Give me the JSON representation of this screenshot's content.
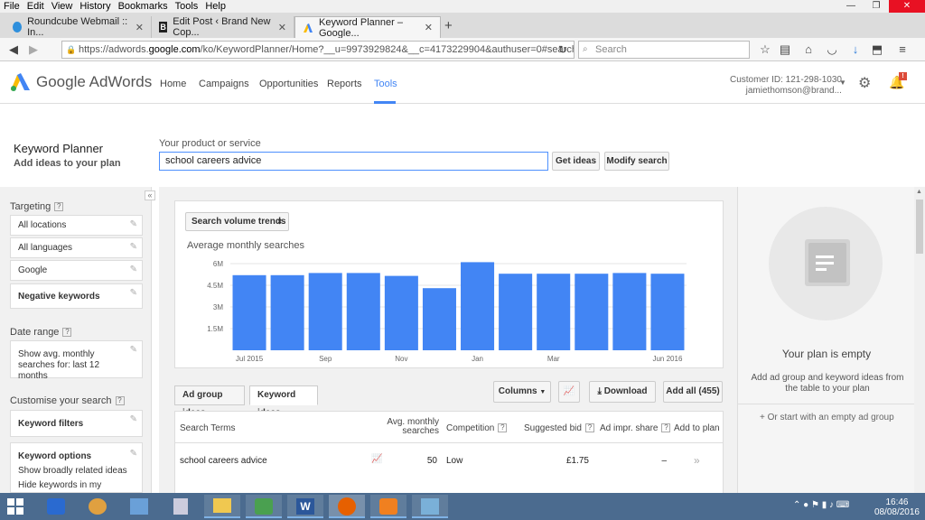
{
  "menubar": {
    "items": [
      "File",
      "Edit",
      "View",
      "History",
      "Bookmarks",
      "Tools",
      "Help"
    ]
  },
  "window_controls": {
    "minimize": "—",
    "restore": "❐",
    "close": "✕"
  },
  "tabs": [
    {
      "label": "Roundcube Webmail :: In...",
      "active": false
    },
    {
      "label": "Edit Post ‹ Brand New Cop...",
      "active": false
    },
    {
      "label": "Keyword Planner – Google...",
      "active": true
    }
  ],
  "new_tab": "+",
  "url": {
    "prefix": "https://adwords.",
    "domain": "google.com",
    "suffix": "/ko/KeywordPlanner/Home?__u=9973929824&__c=4173229904&authuser=0#search"
  },
  "search_placeholder": "Search",
  "adwords": {
    "logo": "Google AdWords",
    "nav": [
      "Home",
      "Campaigns",
      "Opportunities",
      "Reports",
      "Tools"
    ],
    "customer_id": "Customer ID: 121-298-1030",
    "user": "jamiethomson@brand...",
    "notif_count": "!"
  },
  "planner": {
    "title": "Keyword Planner",
    "subtitle": "Add ideas to your plan",
    "product_label": "Your product or service",
    "product_value": "school careers advice",
    "get_ideas": "Get ideas",
    "modify_search": "Modify search"
  },
  "left": {
    "collapse": "«",
    "targeting": "Targeting",
    "locations": "All locations",
    "languages": "All languages",
    "network": "Google",
    "negative": "Negative keywords",
    "date_range": "Date range",
    "date_text": "Show avg. monthly searches for: last 12 months",
    "customise": "Customise your search",
    "filters": "Keyword filters",
    "options": "Keyword options",
    "opt1": "Show broadly related ideas",
    "opt2": "Hide keywords in my account",
    "qmark": "?"
  },
  "chart": {
    "dropdown": "Search volume trends",
    "label": "Average monthly searches"
  },
  "chart_data": {
    "type": "bar",
    "categories": [
      "Jul 2015",
      "Aug 2015",
      "Sep 2015",
      "Oct 2015",
      "Nov 2015",
      "Dec 2015",
      "Jan 2016",
      "Feb 2016",
      "Mar 2016",
      "Apr 2016",
      "May 2016",
      "Jun 2016"
    ],
    "values": [
      5.2,
      5.2,
      5.35,
      5.35,
      5.15,
      4.3,
      6.1,
      5.3,
      5.3,
      5.3,
      5.35,
      5.3
    ],
    "yticks": [
      "1.5M",
      "3M",
      "4.5M",
      "6M"
    ],
    "ytick_values": [
      1.5,
      3,
      4.5,
      6
    ],
    "xtick_labels": [
      {
        "i": 0,
        "label": "Jul 2015"
      },
      {
        "i": 2,
        "label": "Sep"
      },
      {
        "i": 4,
        "label": "Nov"
      },
      {
        "i": 6,
        "label": "Jan"
      },
      {
        "i": 8,
        "label": "Mar"
      },
      {
        "i": 11,
        "label": "Jun 2016"
      }
    ],
    "ylim": [
      0,
      6.5
    ],
    "color": "#4285f4",
    "grid": true
  },
  "idea_tabs": {
    "ad_group": "Ad group ideas",
    "keyword": "Keyword ideas"
  },
  "toolbar": {
    "columns": "Columns",
    "download": "Download",
    "add_all": "Add all (455)"
  },
  "table": {
    "headers": {
      "terms": "Search Terms",
      "avg": "Avg. monthly searches",
      "comp": "Competition",
      "bid": "Suggested bid",
      "impr": "Ad impr. share",
      "add": "Add to plan"
    },
    "row": {
      "term": "school careers advice",
      "avg": "50",
      "comp": "Low",
      "bid": "£1.75",
      "impr": "–",
      "add": "»"
    }
  },
  "plan": {
    "empty_title": "Your plan is empty",
    "empty_text": "Add ad group and keyword ideas from the table to your plan",
    "empty_link": "+ Or start with an empty ad group"
  },
  "clock": {
    "time": "16:46",
    "date": "08/08/2016"
  }
}
